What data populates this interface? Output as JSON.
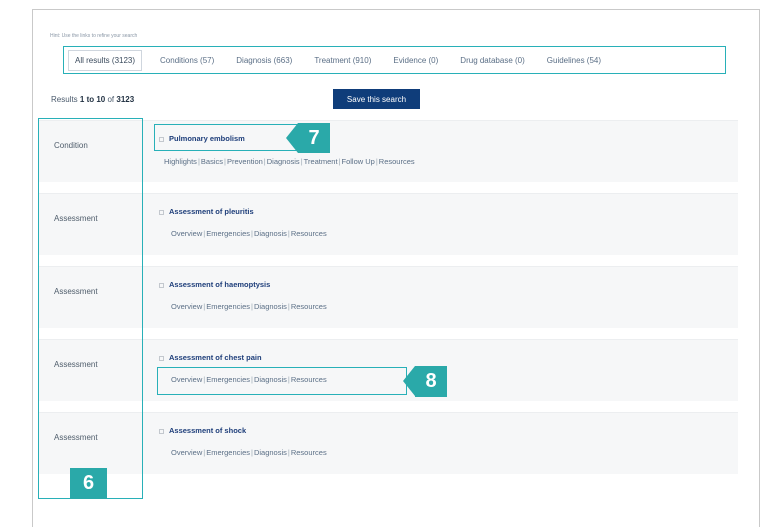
{
  "hint": "Hint: Use the links to refine your search",
  "tabs": [
    {
      "label": "All results (3123)",
      "active": true
    },
    {
      "label": "Conditions (57)",
      "active": false
    },
    {
      "label": "Diagnosis (663)",
      "active": false
    },
    {
      "label": "Treatment (910)",
      "active": false
    },
    {
      "label": "Evidence (0)",
      "active": false
    },
    {
      "label": "Drug database (0)",
      "active": false
    },
    {
      "label": "Guidelines (54)",
      "active": false
    }
  ],
  "results_summary": {
    "prefix": "Results ",
    "range": "1 to 10",
    "of": " of ",
    "total": "3123"
  },
  "save_button": "Save this search",
  "rows": [
    {
      "category": "Condition",
      "title": "Pulmonary embolism",
      "links": [
        "Highlights",
        "Basics",
        "Prevention",
        "Diagnosis",
        "Treatment",
        "Follow Up",
        "Resources"
      ]
    },
    {
      "category": "Assessment",
      "title": "Assessment of pleuritis",
      "links": [
        "Overview",
        "Emergencies",
        "Diagnosis",
        "Resources"
      ]
    },
    {
      "category": "Assessment",
      "title": "Assessment of haemoptysis",
      "links": [
        "Overview",
        "Emergencies",
        "Diagnosis",
        "Resources"
      ]
    },
    {
      "category": "Assessment",
      "title": "Assessment of chest pain",
      "links": [
        "Overview",
        "Emergencies",
        "Diagnosis",
        "Resources"
      ]
    },
    {
      "category": "Assessment",
      "title": "Assessment of shock",
      "links": [
        "Overview",
        "Emergencies",
        "Diagnosis",
        "Resources"
      ]
    }
  ],
  "badges": {
    "category_column": "6",
    "result_title": "7",
    "result_links": "8"
  },
  "colors": {
    "annotation": "#2aa9a9",
    "button": "#0f3d7a",
    "title_link": "#1e3e7a"
  }
}
